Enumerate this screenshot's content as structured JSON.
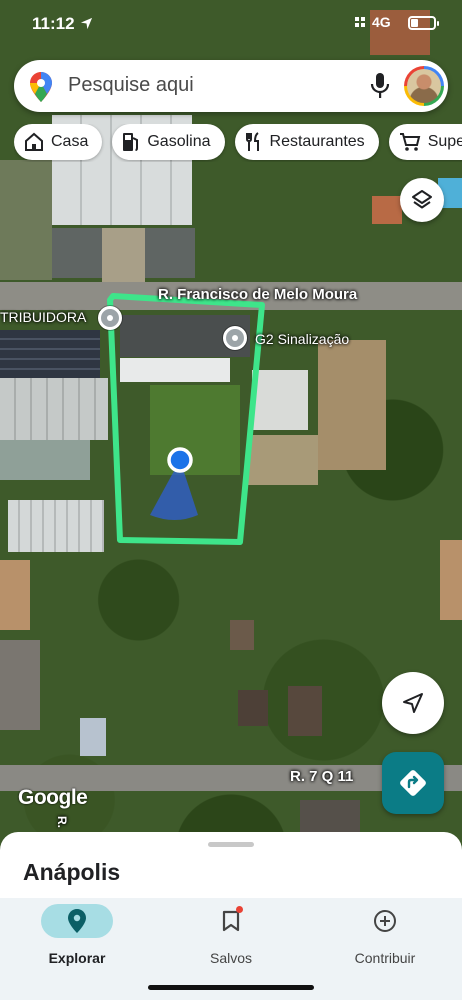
{
  "status_bar": {
    "time": "11:12",
    "network": "4G",
    "battery_level": 0.3
  },
  "search": {
    "placeholder": "Pesquise aqui",
    "pin_icon": "google-maps-pin-icon",
    "mic_icon": "microphone-icon"
  },
  "chips": [
    {
      "label": "Casa",
      "icon": "home-icon"
    },
    {
      "label": "Gasolina",
      "icon": "gas-station-icon"
    },
    {
      "label": "Restaurantes",
      "icon": "fork-knife-icon"
    },
    {
      "label": "Super",
      "icon": "shopping-cart-icon"
    }
  ],
  "map": {
    "road_labels": {
      "main_street": "R. Francisco de Melo Moura",
      "bottom_street": "R. 7 Q 11",
      "side_street": "R."
    },
    "pois": {
      "left": "TRIBUIDORA",
      "right": "G2 Sinalização"
    },
    "attribution": "Google",
    "colors": {
      "drawn_outline": "#3ee58a",
      "location_dot": "#1a73e8",
      "directions_button": "#0b7c86"
    }
  },
  "sheet": {
    "title": "Anápolis"
  },
  "nav": {
    "items": [
      {
        "label": "Explorar",
        "icon": "explore-pin-icon",
        "active": true
      },
      {
        "label": "Salvos",
        "icon": "bookmark-icon",
        "active": false
      },
      {
        "label": "Contribuir",
        "icon": "add-circle-icon",
        "active": false
      }
    ]
  }
}
